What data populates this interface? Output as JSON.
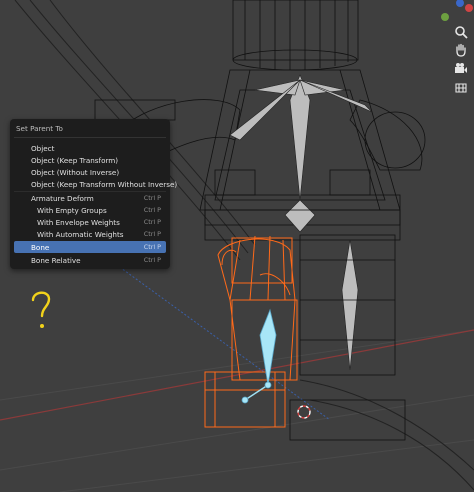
{
  "menu": {
    "title": "Set Parent To",
    "items": [
      {
        "label": "Object",
        "shortcut": ""
      },
      {
        "label": "Object (Keep Transform)",
        "shortcut": ""
      },
      {
        "label": "Object (Without Inverse)",
        "shortcut": ""
      },
      {
        "label": "Object (Keep Transform Without Inverse)",
        "shortcut": ""
      },
      {
        "label": "Armature Deform",
        "shortcut": "Ctrl P"
      },
      {
        "label": "With Empty Groups",
        "shortcut": "Ctrl P"
      },
      {
        "label": "With Envelope Weights",
        "shortcut": "Ctrl P"
      },
      {
        "label": "With Automatic Weights",
        "shortcut": "Ctrl P"
      },
      {
        "label": "Bone",
        "shortcut": "Ctrl P"
      },
      {
        "label": "Bone Relative",
        "shortcut": "Ctrl P"
      }
    ],
    "active_item": "Bone"
  },
  "annotation": {
    "text": "?"
  },
  "colors": {
    "viewport_bg": "#3f3f3f",
    "menu_bg": "#1d1d1d",
    "highlight": "#4772b3",
    "selected_mesh": "#ff6a1a",
    "active_bone": "#7ad0f0",
    "annotation": "#f2d21b"
  },
  "nav_icons": [
    "axis-gizmo-icon",
    "zoom-icon",
    "hand-pan-icon",
    "camera-icon",
    "grid-ortho-icon"
  ]
}
